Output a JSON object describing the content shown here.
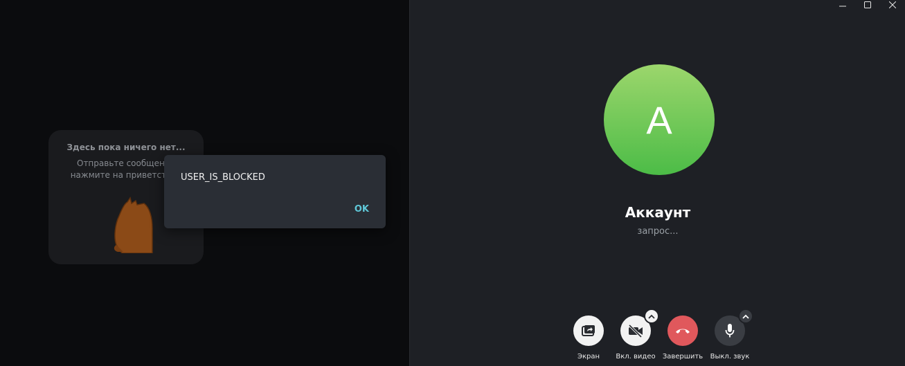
{
  "chat": {
    "empty_title": "Здесь пока ничего нет...",
    "empty_desc": "Отправьте сообщение\nнажмите на приветствие"
  },
  "dialog": {
    "message": "USER_IS_BLOCKED",
    "ok_label": "OK"
  },
  "call": {
    "avatar_letter": "A",
    "peer_name": "Аккаунт",
    "status": "запрос...",
    "controls": {
      "screen_label": "Экран",
      "video_label": "Вкл. видео",
      "end_label": "Завершить",
      "mute_label": "Выкл. звук"
    }
  },
  "colors": {
    "accent": "#5fc8d8",
    "end_call": "#e0585c",
    "avatar_top": "#9cd66c",
    "avatar_bottom": "#4cbc47"
  },
  "icons": [
    "minimize-icon",
    "maximize-icon",
    "close-icon",
    "screen-share-icon",
    "video-off-icon",
    "chevron-up-icon",
    "hang-up-icon",
    "microphone-icon"
  ]
}
